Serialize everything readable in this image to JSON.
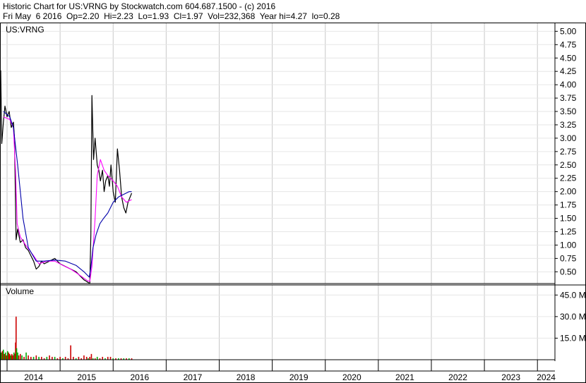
{
  "header": {
    "line1": "Historic Chart for US:VRNG by Stockwatch.com 604.687.1500 - (c) 2016",
    "line2": "Fri May  6 2016  Op=2.20  Hi=2.23  Lo=1.93  Cl=1.97  Vol=232,368  Year hi=4.27  lo=0.28"
  },
  "chart_data": {
    "type": "line",
    "symbol_label": "US:VRNG",
    "volume_label": "Volume",
    "price_axis": {
      "range": [
        0.28,
        5.15
      ],
      "ticks": [
        "5.00",
        "4.75",
        "4.50",
        "4.25",
        "4.00",
        "3.75",
        "3.50",
        "3.25",
        "3.00",
        "2.75",
        "2.50",
        "2.25",
        "2.00",
        "1.75",
        "1.50",
        "1.25",
        "1.00",
        "0.75",
        "0.50"
      ],
      "tick_values": [
        5.0,
        4.75,
        4.5,
        4.25,
        4.0,
        3.75,
        3.5,
        3.25,
        3.0,
        2.75,
        2.5,
        2.25,
        2.0,
        1.75,
        1.5,
        1.25,
        1.0,
        0.75,
        0.5
      ]
    },
    "volume_axis": {
      "range": [
        0,
        52
      ],
      "unit": "M",
      "ticks": [
        "45.0 M",
        "30.0 M",
        "15.0 M"
      ],
      "tick_values": [
        45,
        30,
        15
      ]
    },
    "x_axis": {
      "range": [
        2013.88,
        2024.33
      ],
      "ticks": [
        "2014",
        "2015",
        "2016",
        "2017",
        "2018",
        "2019",
        "2020",
        "2021",
        "2022",
        "2023",
        "2024"
      ],
      "tick_values": [
        2014,
        2015,
        2016,
        2017,
        2018,
        2019,
        2020,
        2021,
        2022,
        2023,
        2024
      ]
    },
    "grid": true,
    "colors": {
      "price": "#000000",
      "ma_short": "#ff00ff",
      "ma_long": "#0000aa",
      "vol_up": "#00aa00",
      "vol_down": "#cc0000",
      "grid": "#c8c8c8"
    },
    "series": [
      {
        "key": "price",
        "x": [
          2013.88,
          2013.9,
          2013.93,
          2013.96,
          2014.0,
          2014.04,
          2014.08,
          2014.12,
          2014.14,
          2014.17,
          2014.2,
          2014.25,
          2014.3,
          2014.35,
          2014.4,
          2014.45,
          2014.5,
          2014.55,
          2014.6,
          2014.65,
          2014.7,
          2014.8,
          2014.9,
          2015.0,
          2015.1,
          2015.2,
          2015.3,
          2015.4,
          2015.45,
          2015.5,
          2015.53,
          2015.56,
          2015.58,
          2015.6,
          2015.63,
          2015.66,
          2015.7,
          2015.73,
          2015.76,
          2015.8,
          2015.83,
          2015.86,
          2015.9,
          2015.93,
          2015.96,
          2016.0,
          2016.04,
          2016.08,
          2016.12,
          2016.16,
          2016.2,
          2016.24,
          2016.28,
          2016.32,
          2016.35
        ],
        "y": [
          4.27,
          2.9,
          3.3,
          3.6,
          3.4,
          3.5,
          3.2,
          3.3,
          3.0,
          1.1,
          1.3,
          1.05,
          1.1,
          0.95,
          0.9,
          0.8,
          0.7,
          0.55,
          0.6,
          0.7,
          0.65,
          0.7,
          0.75,
          0.65,
          0.6,
          0.55,
          0.5,
          0.4,
          0.35,
          0.32,
          0.3,
          0.28,
          1.2,
          3.8,
          2.6,
          3.0,
          2.5,
          2.4,
          2.2,
          2.4,
          2.0,
          2.2,
          2.3,
          2.1,
          2.5,
          2.0,
          1.8,
          2.8,
          2.4,
          1.9,
          1.7,
          1.6,
          1.8,
          1.9,
          1.97
        ]
      },
      {
        "key": "ma_short",
        "x": [
          2013.93,
          2014.05,
          2014.12,
          2014.16,
          2014.19,
          2014.25,
          2014.35,
          2014.5,
          2014.6,
          2014.75,
          2014.9,
          2015.05,
          2015.2,
          2015.35,
          2015.45,
          2015.52,
          2015.56,
          2015.6,
          2015.66,
          2015.7,
          2015.76,
          2015.83,
          2015.9,
          2016.0,
          2016.08,
          2016.16,
          2016.25,
          2016.35
        ],
        "y": [
          3.4,
          3.35,
          3.2,
          2.4,
          1.4,
          1.15,
          1.0,
          0.8,
          0.65,
          0.7,
          0.7,
          0.62,
          0.55,
          0.45,
          0.38,
          0.33,
          0.32,
          0.6,
          1.5,
          2.3,
          2.6,
          2.4,
          2.3,
          2.2,
          2.1,
          1.9,
          1.8,
          1.85
        ]
      },
      {
        "key": "ma_long",
        "x": [
          2013.93,
          2014.05,
          2014.12,
          2014.2,
          2014.3,
          2014.4,
          2014.55,
          2014.7,
          2014.9,
          2015.1,
          2015.3,
          2015.45,
          2015.55,
          2015.58,
          2015.62,
          2015.68,
          2015.75,
          2015.82,
          2015.9,
          2016.0,
          2016.1,
          2016.2,
          2016.3,
          2016.35
        ],
        "y": [
          3.5,
          3.4,
          3.2,
          2.5,
          1.5,
          0.95,
          0.7,
          0.7,
          0.72,
          0.7,
          0.62,
          0.5,
          0.4,
          0.58,
          0.95,
          1.2,
          1.4,
          1.5,
          1.6,
          1.8,
          1.9,
          1.95,
          2.0,
          2.0
        ]
      }
    ],
    "volume": {
      "x": [
        2013.89,
        2013.91,
        2013.93,
        2013.95,
        2013.97,
        2013.99,
        2014.01,
        2014.03,
        2014.05,
        2014.07,
        2014.09,
        2014.11,
        2014.13,
        2014.15,
        2014.16,
        2014.17,
        2014.18,
        2014.2,
        2014.22,
        2014.25,
        2014.28,
        2014.32,
        2014.36,
        2014.4,
        2014.45,
        2014.5,
        2014.55,
        2014.6,
        2014.65,
        2014.7,
        2014.75,
        2014.8,
        2014.85,
        2014.9,
        2014.95,
        2015.0,
        2015.05,
        2015.1,
        2015.15,
        2015.2,
        2015.25,
        2015.3,
        2015.35,
        2015.4,
        2015.45,
        2015.5,
        2015.53,
        2015.56,
        2015.59,
        2015.62,
        2015.66,
        2015.7,
        2015.75,
        2015.8,
        2015.85,
        2015.9,
        2015.95,
        2016.0,
        2016.05,
        2016.1,
        2016.15,
        2016.2,
        2016.25,
        2016.3,
        2016.35
      ],
      "values": [
        5,
        6,
        7,
        4,
        5,
        3,
        6,
        5,
        4,
        3,
        4,
        3,
        5,
        4,
        12,
        30,
        8,
        5,
        3,
        4,
        3,
        2,
        5,
        3,
        2,
        2,
        3,
        2,
        2,
        1,
        2,
        3,
        2,
        2,
        1,
        2,
        1,
        2,
        1,
        10,
        2,
        1,
        2,
        1,
        3,
        2,
        1,
        2,
        4,
        1,
        1,
        2,
        1,
        2,
        1,
        2,
        2,
        1,
        1,
        1,
        1,
        1,
        1,
        1,
        1
      ],
      "up": [
        1,
        0,
        1,
        0,
        1,
        0,
        1,
        0,
        0,
        1,
        0,
        0,
        1,
        0,
        0,
        0,
        1,
        1,
        0,
        0,
        1,
        0,
        1,
        0,
        0,
        1,
        0,
        1,
        0,
        0,
        1,
        0,
        0,
        1,
        0,
        0,
        1,
        0,
        0,
        0,
        0,
        1,
        0,
        0,
        0,
        0,
        1,
        0,
        0,
        1,
        0,
        1,
        0,
        0,
        1,
        0,
        0,
        1,
        0,
        1,
        0,
        1,
        0,
        1,
        0
      ]
    }
  }
}
